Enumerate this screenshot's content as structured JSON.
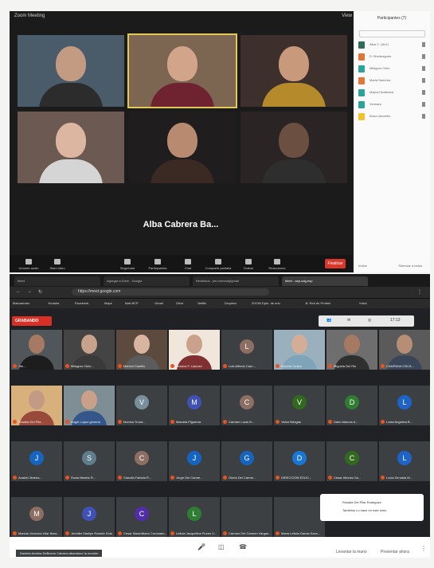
{
  "zoom": {
    "window_title": "Zoom Meeting",
    "top_right": "View",
    "speaker_note": "Alba Cabrera Ba...",
    "end_button": "Finalizar",
    "toolbar": [
      {
        "label": "Unmute audio"
      },
      {
        "label": "Start video"
      },
      {
        "label": "Seguridad"
      },
      {
        "label": "Participantes"
      },
      {
        "label": "Chat"
      },
      {
        "label": "Compartir pantalla"
      },
      {
        "label": "Grabar"
      },
      {
        "label": "Reacciones"
      }
    ],
    "tiles": [
      {
        "name": "",
        "bg": "#4a5b6a",
        "skin": "#c39a82",
        "cloth": "#2c2c2c"
      },
      {
        "name": "",
        "bg": "#7c6652",
        "skin": "#d2a58b",
        "cloth": "#6f2230",
        "active": true
      },
      {
        "name": "",
        "bg": "#3d2f2b",
        "skin": "#c89a7b",
        "cloth": "#b48a2a"
      },
      {
        "name": "",
        "bg": "#6c5a52",
        "skin": "#dcb6a0",
        "cloth": "#d5d5d5"
      },
      {
        "name": "",
        "bg": "#1f1d1d",
        "skin": "#b88a70",
        "cloth": "#3b2a23"
      },
      {
        "name": "",
        "bg": "#2a2524",
        "skin": "#6b4f40",
        "cloth": "#2e2e2e"
      }
    ],
    "panel": {
      "title": "Participantes (7)",
      "search": "",
      "rows": [
        {
          "text": "Alba C. (Anf.)",
          "color": "#2e6b5a"
        },
        {
          "text": "D. Monteagudo",
          "color": "#e0763a"
        },
        {
          "text": "Milagros Cielo",
          "color": "#2ba39a"
        },
        {
          "text": "Maria Sanchez",
          "color": "#e0763a"
        },
        {
          "text": "Mayra Huallanca",
          "color": "#2ba39a"
        },
        {
          "text": "Xiomara",
          "color": "#2ba39a"
        },
        {
          "text": "Bravo Amarillo",
          "color": "#f2c12e"
        }
      ],
      "foot_left": "Invitar",
      "foot_right": "Silenciar a todos"
    }
  },
  "browser": {
    "tabs": [
      "Meet",
      "Agregar a Drive - Google",
      "Recibidos - jim.herrera@gmail",
      "Meet - sep-cdg-esp"
    ],
    "url": "https://meet.google.com",
    "bookmarks": [
      "Marcadores",
      "Youtube",
      "Facebook",
      "Maps",
      "Mail BCP",
      "Gmail",
      "Drive",
      "Netflix",
      "Dropbox",
      "ZOOM Dpto. de edu",
      "B. Red de Profesi",
      "Inicio"
    ],
    "recording_label": "GRABANDO",
    "time": "17:13",
    "meet_tiles": [
      {
        "label": "Jim...",
        "letter": "",
        "color": "#3c4043",
        "video": true,
        "skin": "#a67a62",
        "cloth": "#1d1d1d",
        "bg": "#50565a"
      },
      {
        "label": "Milagros Cielo...",
        "letter": "",
        "color": "#3c4043",
        "video": true,
        "skin": "#c7a28c",
        "cloth": "#3a3a3a",
        "bg": "#444"
      },
      {
        "label": "Marisol Castillo",
        "letter": "",
        "color": "#3c4043",
        "video": true,
        "skin": "#d8b59f",
        "cloth": "#5b5b5b",
        "bg": "#5c4a3e"
      },
      {
        "label": "Jessica F. Llancari",
        "letter": "",
        "color": "#3c4043",
        "video": true,
        "skin": "#caa18a",
        "cloth": "#803030",
        "bg": "#f1e6dc"
      },
      {
        "label": "Luis Alfredo Cam...",
        "letter": "L",
        "color": "#8d6e63",
        "video": false
      },
      {
        "label": "Mariela Castro",
        "letter": "",
        "color": "#3c4043",
        "video": true,
        "skin": "#d3ad96",
        "cloth": "#7fa3b9",
        "bg": "#9ab0bd"
      },
      {
        "label": "Miguela Del Rio",
        "letter": "",
        "color": "#3c4043",
        "video": true,
        "skin": "#a67a62",
        "cloth": "#2f2f2f",
        "bg": "#6e6e6e"
      },
      {
        "label": "CAMPANA OSCA...",
        "letter": "",
        "color": "#3c4043",
        "video": true,
        "skin": "#b68e76",
        "cloth": "#39465a",
        "bg": "#5a5a5a"
      },
      {
        "label": "Rosalia Del Pila...",
        "letter": "",
        "color": "#3c4043",
        "video": true,
        "skin": "#c39b84",
        "cloth": "#9a4a3b",
        "bg": "#d7b07c"
      },
      {
        "label": "Angel Lopez general",
        "letter": "",
        "color": "#3c4043",
        "video": true,
        "skin": "#c9a18a",
        "cloth": "#34568b",
        "bg": "#7f8d94"
      },
      {
        "label": "Monica Trona...",
        "letter": "V",
        "color": "#78909c",
        "video": false
      },
      {
        "label": "Marcela Figueroa",
        "letter": "M",
        "color": "#3f51b5",
        "video": false
      },
      {
        "label": "Carmen Lucia N...",
        "letter": "C",
        "color": "#8d6e63",
        "video": false
      },
      {
        "label": "Victor Bringas",
        "letter": "V",
        "color": "#33691e",
        "video": false
      },
      {
        "label": "Dario Marcos A...",
        "letter": "D",
        "color": "#2e7d32",
        "video": false
      },
      {
        "label": "Luisa Angelica B...",
        "letter": "L",
        "color": "#1e63c7",
        "video": false
      },
      {
        "label": "Anabel Jimena...",
        "letter": "J",
        "color": "#1565c0",
        "video": false
      },
      {
        "label": "Sonia Beatriz R...",
        "letter": "S",
        "color": "#607d8b",
        "video": false
      },
      {
        "label": "Claudia Fabiola R...",
        "letter": "C",
        "color": "#8d6e63",
        "video": false
      },
      {
        "label": "Jorge Del Carme...",
        "letter": "J",
        "color": "#1565c0",
        "video": false
      },
      {
        "label": "Gloria Del Carme...",
        "letter": "G",
        "color": "#1565c0",
        "video": false
      },
      {
        "label": "DIRECCION EDUC...",
        "letter": "D",
        "color": "#1976d2",
        "video": false
      },
      {
        "label": "Cesar Alfonso Sa...",
        "letter": "C",
        "color": "#33691e",
        "video": false
      },
      {
        "label": "Lucia Zenaida M...",
        "letter": "L",
        "color": "#1e63c7",
        "video": false
      },
      {
        "label": "Maricia Veronica Vilar Bara...",
        "letter": "M",
        "color": "#8d6e63",
        "video": false
      },
      {
        "label": "Jennifer Marilyn Rosello Soto",
        "letter": "J",
        "color": "#3f51b5",
        "video": false
      },
      {
        "label": "Cesar Maximiliano Coronado...",
        "letter": "C",
        "color": "#512da8",
        "video": false
      },
      {
        "label": "Leticia Jacqueline Flores V...",
        "letter": "L",
        "color": "#2e7d32",
        "video": false
      },
      {
        "label": "Carmen Del Carmen Vargas...",
        "letter": "",
        "color": "#3c4043",
        "video": false
      },
      {
        "label": "Maria Leticia Garcia Sanc...",
        "letter": "",
        "color": "#3c4043",
        "video": false
      }
    ],
    "toast_line1": "Rosalia Del Pilar Rodriguez",
    "toast_line2": "Tardellos Lo hace en este lomo",
    "notice": "Daniela Andrea DeBueno Cabrera abandonó la reunión",
    "bottom": {
      "raise_hand": "Levantar la mano",
      "present": "Presentar ahora",
      "more": "⋮"
    }
  }
}
